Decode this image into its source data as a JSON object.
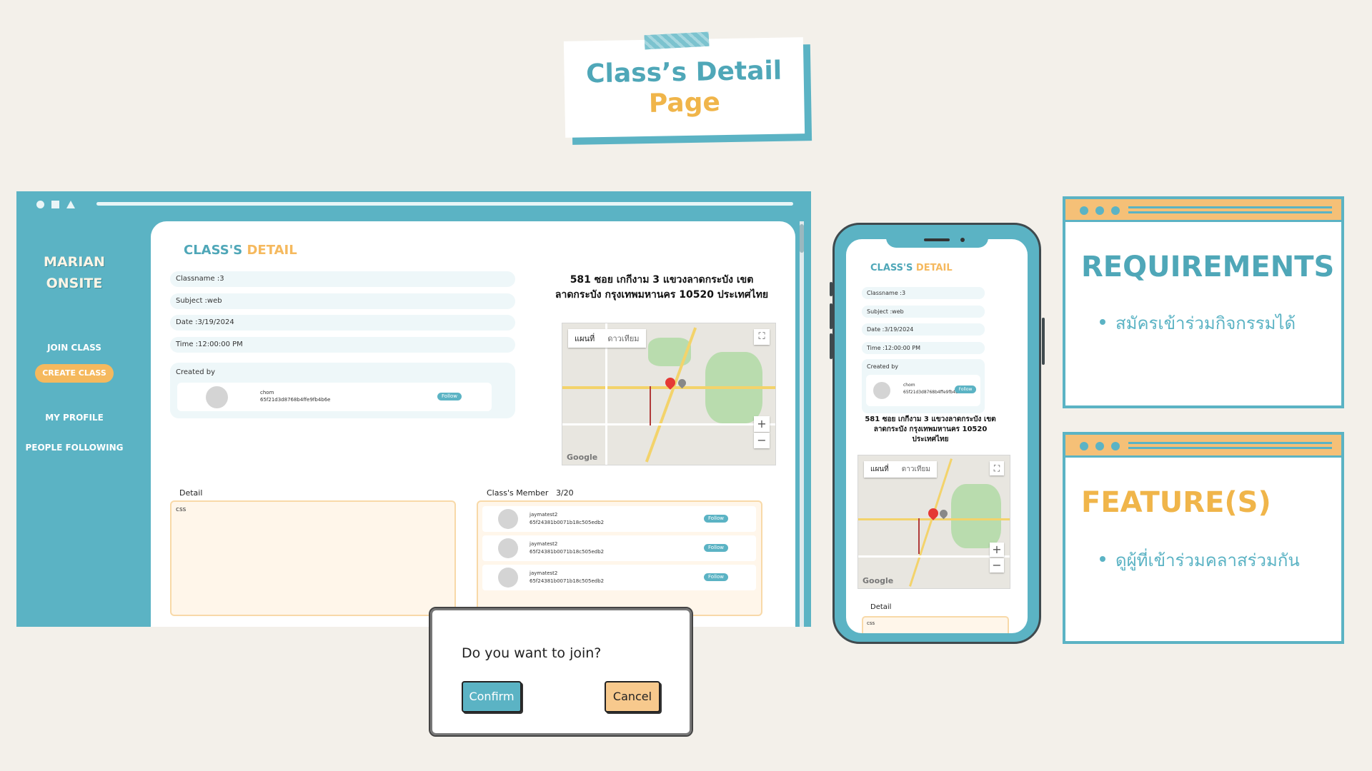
{
  "slide_title": {
    "line1": "Class’s  Detail",
    "line2": "Page"
  },
  "desktop": {
    "brand_line1": "MARIAN",
    "brand_line2": "ONSITE",
    "nav": {
      "join_class": "JOIN CLASS",
      "create_class": "CREATE CLASS",
      "my_profile": "MY PROFILE",
      "people_following": "PEOPLE FOLLOWING"
    },
    "heading_part1": "CLASS'S ",
    "heading_part2": "DETAIL",
    "fields": {
      "classname": "Classname :3",
      "subject": "Subject :web",
      "date": "Date :3/19/2024",
      "time": "Time :12:00:00 PM"
    },
    "created_by_label": "Created by",
    "creator": {
      "name": "chom",
      "id": "65f21d3d8768b4ffe9fb4b6e",
      "follow": "Follow"
    },
    "address": "581 ซอย เกกีงาม 3 แขวงลาดกระบัง เขต ลาดกระบัง กรุงเทพมหานคร 10520 ประเทศไทย",
    "map": {
      "tab_map": "แผนที่",
      "tab_satellite": "ดาวเทียม",
      "google": "Google",
      "zoom_in": "+",
      "zoom_out": "−",
      "fullscreen": "⛶"
    },
    "detail_label": "Detail",
    "detail_text": "css",
    "members_label": "Class's Member",
    "members_count": "3/20",
    "members": [
      {
        "name": "jaymatest2",
        "id": "65f24381b0071b18c505edb2",
        "follow": "Follow"
      },
      {
        "name": "jaymatest2",
        "id": "65f24381b0071b18c505edb2",
        "follow": "Follow"
      },
      {
        "name": "jaymatest2",
        "id": "65f24381b0071b18c505edb2",
        "follow": "Follow"
      }
    ]
  },
  "dialog": {
    "question": "Do you want to join?",
    "confirm": "Confirm",
    "cancel": "Cancel"
  },
  "mobile": {
    "heading_part1": "CLASS'S ",
    "heading_part2": "DETAIL",
    "fields": {
      "classname": "Classname :3",
      "subject": "Subject :web",
      "date": "Date :3/19/2024",
      "time": "Time :12:00:00 PM"
    },
    "created_by_label": "Created by",
    "creator": {
      "name": "chom",
      "id": "65f21d3d8768b4ffe9fb4b6e",
      "follow": "Follow"
    },
    "address": "581 ซอย เกกีงาม 3 แขวงลาดกระบัง เขต ลาดกระบัง กรุงเทพมหานคร 10520 ประเทศไทย",
    "detail_label": "Detail",
    "detail_text": "css"
  },
  "requirements": {
    "title": "REQUIREMENTS",
    "items": [
      "สมัครเข้าร่วมกิจกรรมได้"
    ]
  },
  "features": {
    "title": "FEATURE(S)",
    "items": [
      "ดูผู้ที่เข้าร่วมคลาสร่วมกัน"
    ]
  },
  "colors": {
    "teal": "#5bb3c4",
    "orange": "#f5b95e",
    "cream": "#fff6ea",
    "background": "#f3f0ea"
  }
}
